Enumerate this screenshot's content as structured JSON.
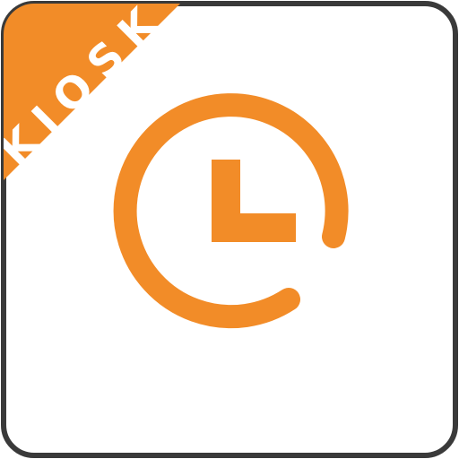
{
  "app_icon": {
    "ribbon_label": "KIOSK",
    "icon_name": "clock-icon",
    "colors": {
      "accent": "#F28C28",
      "background": "#FFFFFF",
      "border": "#3A3A3A"
    }
  }
}
